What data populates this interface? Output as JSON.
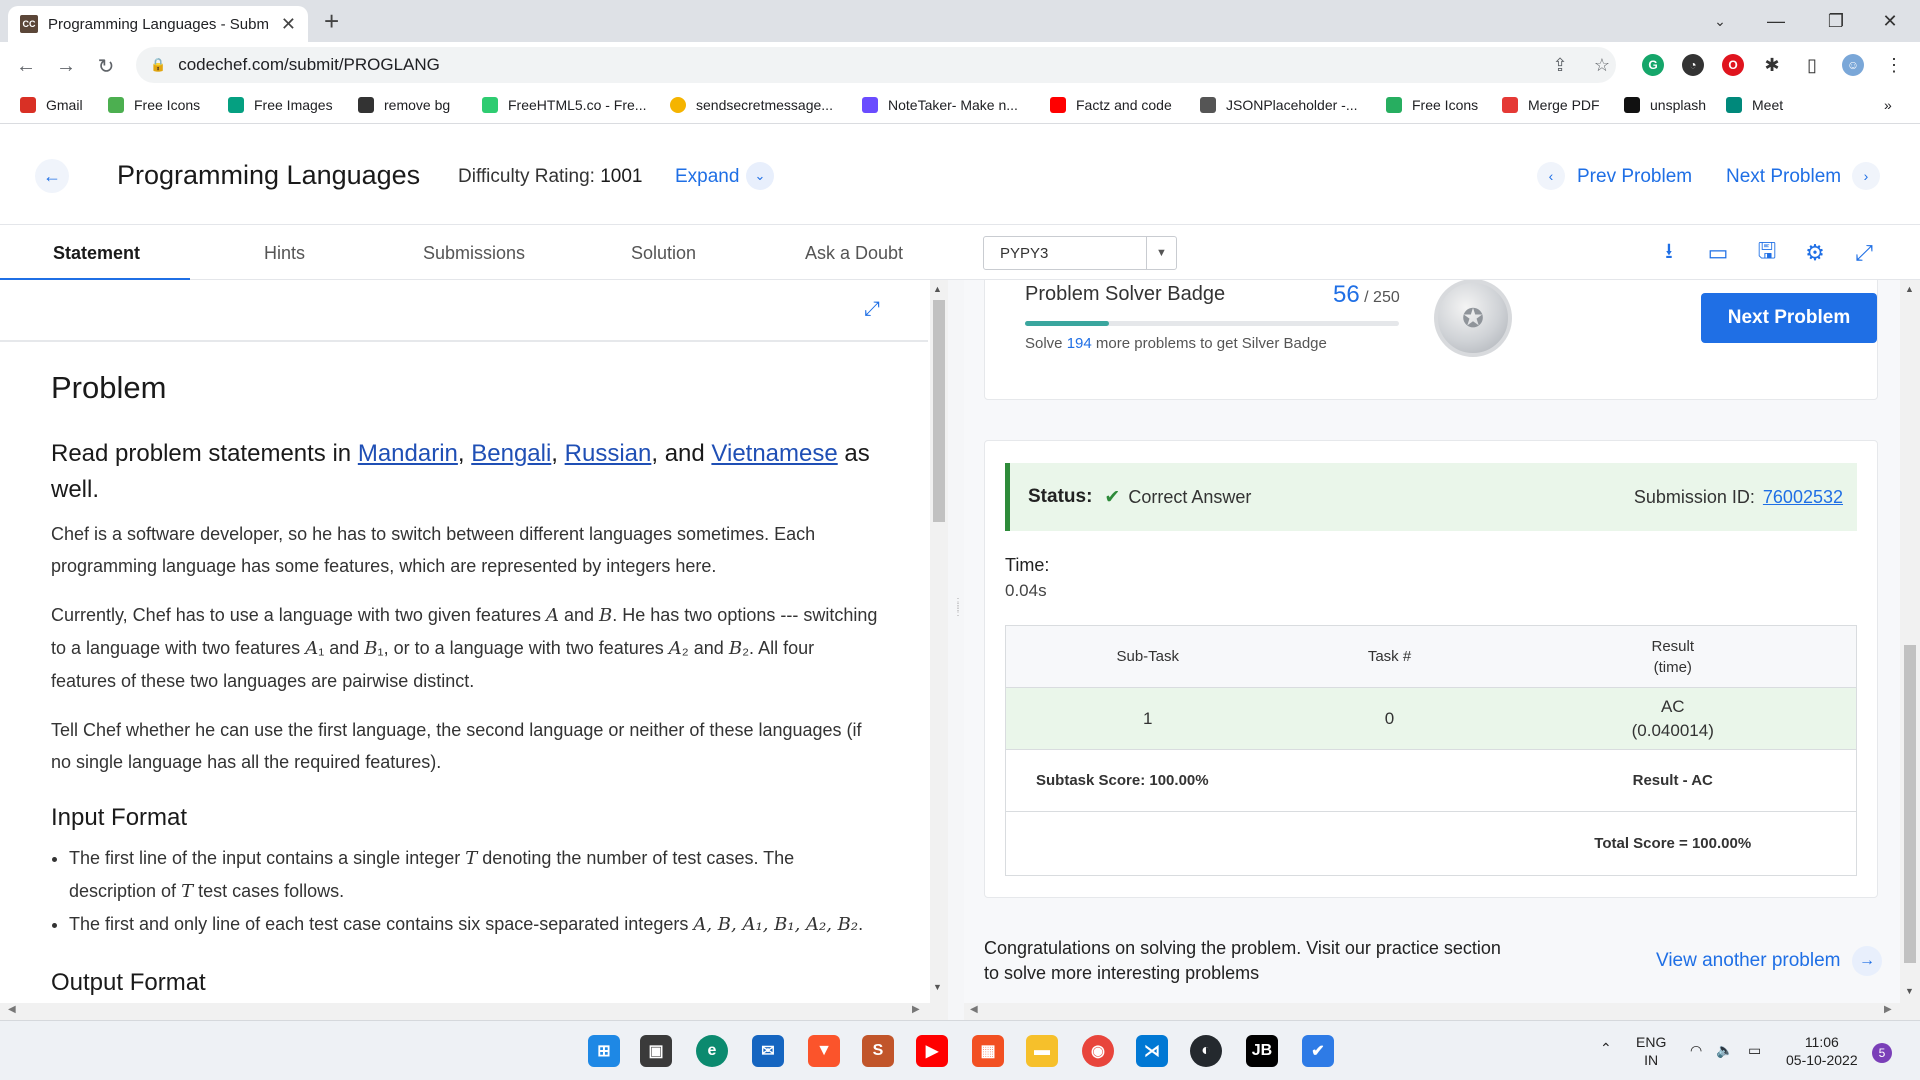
{
  "browser": {
    "tab_title": "Programming Languages - Subm",
    "tab_favicon": "CC",
    "url": "codechef.com/submit/PROGLANG",
    "bookmarks": [
      {
        "label": "Gmail",
        "color": "#d93025"
      },
      {
        "label": "Free Icons",
        "color": "#4caf50"
      },
      {
        "label": "Free Images",
        "color": "#05a081"
      },
      {
        "label": "remove bg",
        "color": "#333333"
      },
      {
        "label": "FreeHTML5.co - Fre...",
        "color": "#2ecc71"
      },
      {
        "label": "sendsecretmessage...",
        "color": "#f5b400"
      },
      {
        "label": "NoteTaker- Make n...",
        "color": "#6a4cff"
      },
      {
        "label": "Factz and code",
        "color": "#ff0000"
      },
      {
        "label": "JSONPlaceholder -...",
        "color": "#555555"
      },
      {
        "label": "Free Icons",
        "color": "#27ae60"
      },
      {
        "label": "Merge PDF",
        "color": "#e53935"
      },
      {
        "label": "unsplash",
        "color": "#111111"
      },
      {
        "label": "Meet",
        "color": "#00897b"
      }
    ],
    "bookmarks_more": "»"
  },
  "header": {
    "title": "Programming Languages",
    "difficulty_label": "Difficulty Rating:",
    "difficulty_value": "1001",
    "expand": "Expand",
    "prev": "Prev Problem",
    "next": "Next Problem"
  },
  "tabs": [
    "Statement",
    "Hints",
    "Submissions",
    "Solution",
    "Ask a Doubt"
  ],
  "language": "PYPY3",
  "statement": {
    "heading": "Problem",
    "read_prefix": "Read problem statements in",
    "languages": [
      "Mandarin",
      "Bengali",
      "Russian",
      "Vietnamese"
    ],
    "read_suffix": "as well.",
    "p1": "Chef is a software developer, so he has to switch between different languages sometimes. Each programming language has some features, which are represented by integers here.",
    "p2a": "Currently, Chef has to use a language with two given features",
    "p2b": "He has two options --- switching to a language with two features",
    "p2c": "or to a language with two features",
    "p2d": "All four features of these two languages are pairwise distinct.",
    "p3": "Tell Chef whether he can use the first language, the second language or neither of these languages (if no single language has all the required features).",
    "input_heading": "Input Format",
    "input_1a": "The first line of the input contains a single integer",
    "input_1b": "denoting the number of test cases. The description of",
    "input_1c": "test cases follows.",
    "input_2": "The first and only line of each test case contains six space-separated integers",
    "output_heading": "Output Format"
  },
  "badge": {
    "title": "Problem Solver Badge",
    "count": "56",
    "total": "/ 250",
    "progress_fraction": 0.224,
    "sub_prefix": "Solve",
    "sub_num": "194",
    "sub_suffix": "more problems to get Silver Badge",
    "next_button": "Next Problem"
  },
  "result": {
    "status_label": "Status:",
    "status_value": "Correct Answer",
    "submission_label": "Submission ID:",
    "submission_id": "76002532",
    "time_label": "Time:",
    "time_value": "0.04s",
    "table_headers": [
      "Sub-Task",
      "Task #",
      "Result\n(time)"
    ],
    "rows": [
      {
        "subtask": "1",
        "task": "0",
        "result": "AC",
        "time": "(0.040014)"
      }
    ],
    "subtask_score": "Subtask Score: 100.00%",
    "result_ac": "Result - AC",
    "total_score": "Total Score = 100.00%"
  },
  "footer": {
    "congrats": "Congratulations on solving the problem. Visit our practice section to solve more interesting problems",
    "view_another": "View another problem"
  },
  "taskbar": {
    "lang_top": "ENG",
    "lang_bottom": "IN",
    "time": "11:06",
    "date": "05-10-2022",
    "notifications": "5"
  }
}
